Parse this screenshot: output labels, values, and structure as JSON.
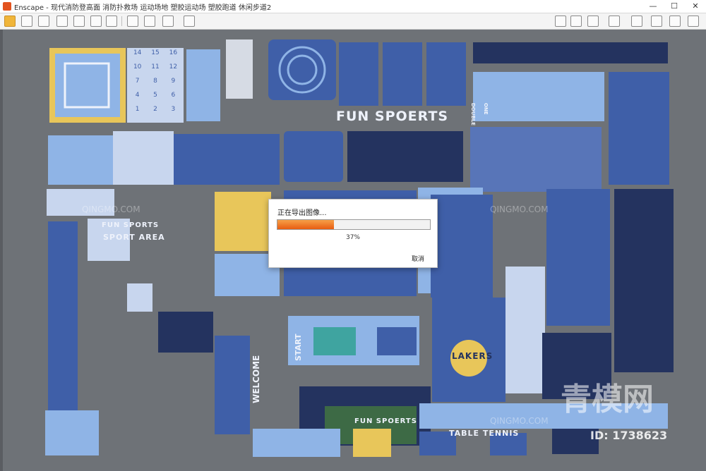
{
  "window": {
    "app_title": "Enscape - 现代消防登高面 消防扑救场 运动场地 塑胶运动场 塑胶跑道 休闲步道2",
    "minimize": "—",
    "maximize": "☐",
    "close": "✕"
  },
  "colors": {
    "accent": "#e2531f",
    "progress": "#ee6a1c",
    "board_blue": "#3f5fa8",
    "light_blue": "#8fb4e6",
    "pale": "#c8d6ee",
    "yellow": "#e8c65a",
    "navy": "#24335f"
  },
  "toolbar": {
    "icons": [
      "home-icon",
      "link-icon",
      "document-icon",
      "gamepad-icon",
      "bookmark-icon",
      "video-icon",
      "clapper-icon",
      "image-export-icon",
      "panorama-icon",
      "video-export-icon",
      "batch-render-icon",
      "map-icon",
      "asset-library-icon",
      "cube-icon",
      "vr-icon",
      "visual-settings-icon",
      "help-icon",
      "eye-icon",
      "settings-icon"
    ]
  },
  "scene": {
    "fun_title": "FUN SPOERTS",
    "sports_area": "SPORT AREA",
    "fun_sports": "FUN SPORTS",
    "welcome": "WELCOME",
    "start": "START",
    "fun_sports_bottom": "FUN SPOERTS",
    "table_tennis": "TABLE TENNIS",
    "lakers": "LAKERS",
    "double": "DOUBLE",
    "one": "ONE",
    "numbers": [
      "14",
      "15",
      "16",
      "10",
      "11",
      "12",
      "7",
      "8",
      "9",
      "4",
      "5",
      "6",
      "1",
      "2",
      "3"
    ]
  },
  "export_dialog": {
    "title": "正在导出图像...",
    "progress": 0.37,
    "percent_text": "37%",
    "cancel": "取消"
  },
  "watermark": {
    "brand": "青模网",
    "id_text": "ID: 1738623",
    "domain": "QINGMO.COM"
  }
}
